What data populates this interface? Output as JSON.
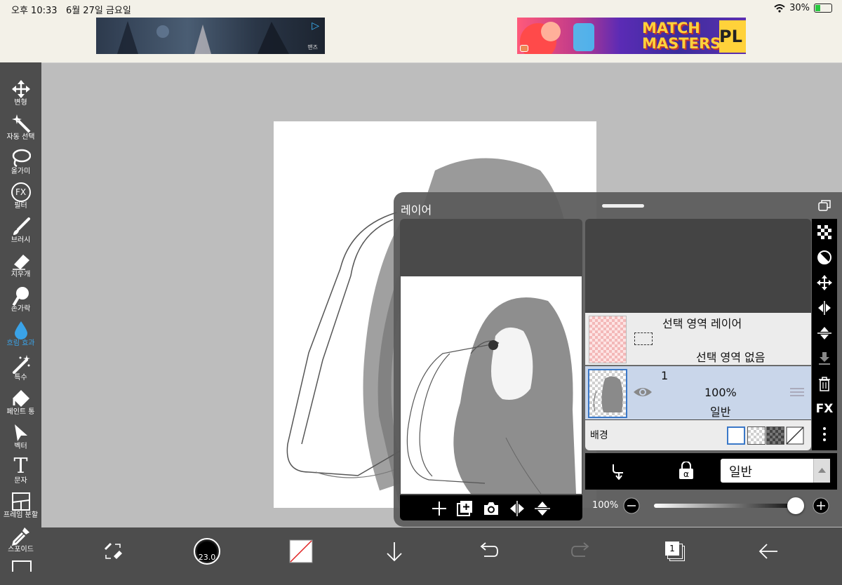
{
  "status": {
    "time": "오후 10:33",
    "date": "6월 27일 금요일",
    "battery": "30%",
    "battery_level": 0.3
  },
  "ads": {
    "left_tag": "맨즈",
    "right_title_1": "MATCH",
    "right_title_2": "MASTERS",
    "right_suffix": "PL"
  },
  "tools": [
    {
      "name": "move",
      "label": "변형",
      "icon": "move-icon"
    },
    {
      "name": "magic-wand",
      "label": "자동 선택",
      "icon": "magic-wand-icon"
    },
    {
      "name": "lasso",
      "label": "올가미",
      "icon": "lasso-icon"
    },
    {
      "name": "filter",
      "label": "필터",
      "icon": "fx-icon",
      "glyph": "FX"
    },
    {
      "name": "brush",
      "label": "브러시",
      "icon": "brush-icon"
    },
    {
      "name": "eraser",
      "label": "지우개",
      "icon": "eraser-icon"
    },
    {
      "name": "finger",
      "label": "손가락",
      "icon": "finger-icon"
    },
    {
      "name": "blur",
      "label": "흐림 효과",
      "icon": "drop-icon",
      "active": true
    },
    {
      "name": "special",
      "label": "특수",
      "icon": "sparkle-icon"
    },
    {
      "name": "bucket",
      "label": "페인트 통",
      "icon": "bucket-icon"
    },
    {
      "name": "vector",
      "label": "벡터",
      "icon": "cursor-icon"
    },
    {
      "name": "text",
      "label": "문자",
      "icon": "text-icon",
      "glyph": "T"
    },
    {
      "name": "frame",
      "label": "프레임 분할",
      "icon": "frame-icon"
    },
    {
      "name": "eyedropper",
      "label": "스포이드",
      "icon": "eyedropper-icon"
    }
  ],
  "bottom": {
    "brush_size": "23.0",
    "layer_count": "1"
  },
  "layer_panel": {
    "title": "레이어",
    "selection_layer": {
      "name": "선택 영역 레이어",
      "status": "선택 영역 없음"
    },
    "layer1": {
      "name": "1",
      "opacity": "100%",
      "blend": "일반"
    },
    "background_label": "배경",
    "blend_mode": "일반",
    "opacity_label": "100%",
    "opacity_value": 1.0,
    "side_fx": "FX"
  },
  "colors": {
    "toolbar_bg": "#4d4d4d",
    "active_tool": "#3aa3e8",
    "selected_layer_bg": "#c9d6ea"
  }
}
